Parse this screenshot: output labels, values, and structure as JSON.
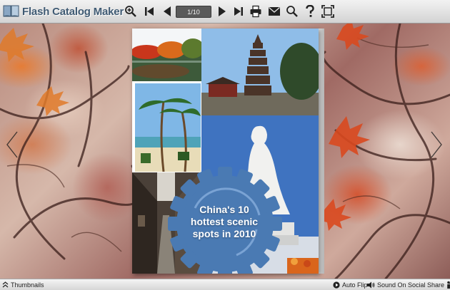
{
  "app": {
    "title": "Flash Catalog Maker"
  },
  "toolbar": {
    "page_indicator": "1/10",
    "buttons": [
      {
        "name": "zoom-in",
        "icon": "magnifier-plus-icon"
      },
      {
        "name": "first-page",
        "icon": "first-page-icon"
      },
      {
        "name": "previous-page",
        "icon": "previous-icon"
      },
      {
        "name": "next-page",
        "icon": "next-icon"
      },
      {
        "name": "last-page",
        "icon": "last-page-icon"
      },
      {
        "name": "email",
        "icon": "envelope-icon"
      },
      {
        "name": "search",
        "icon": "search-icon"
      },
      {
        "name": "help",
        "icon": "question-icon"
      },
      {
        "name": "fullscreen",
        "icon": "fullscreen-icon"
      }
    ]
  },
  "page": {
    "cover_title_lines": [
      "China's 10",
      "hottest scenic",
      "spots in 2010"
    ]
  },
  "bottombar": {
    "thumbnails_label": "Thumbnails",
    "auto_flip_label": "Auto Flip",
    "sound_label": "Sound On",
    "social_share_label": "Social Share"
  },
  "colors": {
    "toolbar_bg": "#d9d9d9",
    "logo_text": "#3f5a73",
    "gear_badge": "#4a7ab3",
    "page_indicator_bg": "#5a5a5a"
  }
}
